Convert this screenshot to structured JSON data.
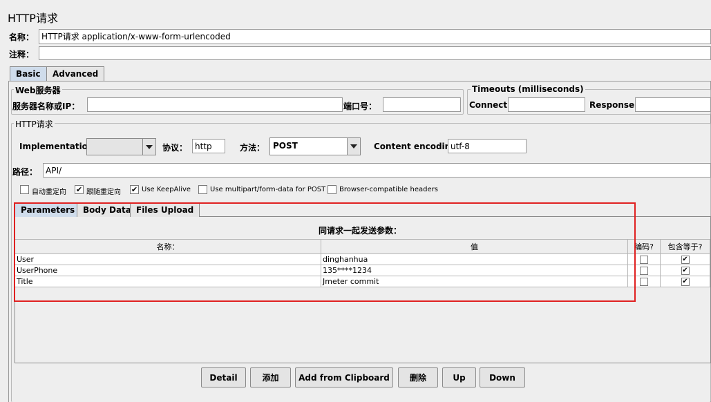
{
  "title": "HTTP请求",
  "name": {
    "label": "名称：",
    "value": "HTTP请求  application/x-www-form-urlencoded"
  },
  "comment": {
    "label": "注释：",
    "value": ""
  },
  "tabs": [
    "Basic",
    "Advanced"
  ],
  "web_server": {
    "legend": "Web服务器",
    "server_label": "服务器名称或IP：",
    "server_value": "",
    "port_label": "端口号：",
    "port_value": ""
  },
  "timeouts": {
    "legend": "Timeouts (milliseconds)",
    "connect_label": "Connect:",
    "response_label": "Response:"
  },
  "http_request": {
    "legend": "HTTP请求",
    "implementation_label": "Implementation:",
    "implementation_value": "",
    "protocol_label": "协议：",
    "protocol_value": "http",
    "method_label": "方法：",
    "method_value": "POST",
    "encoding_label": "Content encoding:",
    "encoding_value": "utf-8",
    "path_label": "路径：",
    "path_value": "API/"
  },
  "options": [
    {
      "label": "自动重定向",
      "checked": false
    },
    {
      "label": "跟随重定向",
      "checked": true
    },
    {
      "label": "Use KeepAlive",
      "checked": true
    },
    {
      "label": "Use multipart/form-data for POST",
      "checked": false
    },
    {
      "label": "Browser-compatible headers",
      "checked": false
    }
  ],
  "param_tabs": [
    "Parameters",
    "Body Data",
    "Files Upload"
  ],
  "params": {
    "heading": "同请求一起发送参数：",
    "columns": [
      "名称：",
      "值",
      "编码?",
      "包含等于?"
    ],
    "rows": [
      {
        "name": "User",
        "value": "dinghanhua",
        "encode": false,
        "include_equals": true
      },
      {
        "name": "UserPhone",
        "value": "135****1234",
        "encode": false,
        "include_equals": true
      },
      {
        "name": "Title",
        "value": "Jmeter commit",
        "encode": false,
        "include_equals": true
      }
    ]
  },
  "buttons": [
    "Detail",
    "添加",
    "Add from Clipboard",
    "删除",
    "Up",
    "Down"
  ],
  "check_mark": "✔",
  "colors": {
    "highlight": "#e02020",
    "active_tab": "#cfdceb"
  }
}
